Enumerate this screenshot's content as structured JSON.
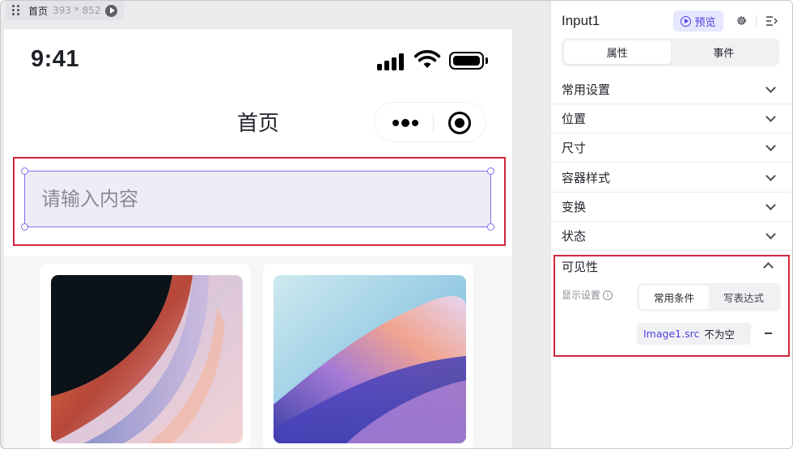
{
  "canvas": {
    "page_label": "首页",
    "page_size": "393 * 852"
  },
  "phone": {
    "time": "9:41",
    "nav_title": "首页",
    "input_placeholder": "请输入内容"
  },
  "panel": {
    "title": "Input1",
    "preview_label": "预览",
    "tabs": [
      {
        "label": "属性",
        "active": true
      },
      {
        "label": "事件",
        "active": false
      }
    ],
    "sections": [
      {
        "label": "常用设置"
      },
      {
        "label": "位置"
      },
      {
        "label": "尺寸"
      },
      {
        "label": "容器样式"
      },
      {
        "label": "变换"
      },
      {
        "label": "状态"
      }
    ],
    "visibility": {
      "title": "可见性",
      "display_label": "显示设置",
      "info_symbol": "i",
      "options": [
        {
          "label": "常用条件",
          "active": true
        },
        {
          "label": "写表达式",
          "active": false
        }
      ],
      "condition": {
        "variable": "Image1.src",
        "operator": "不为空"
      }
    }
  },
  "colors": {
    "accent": "#4c3fe0",
    "highlight": "#d1253d",
    "selection": "#7d70f0"
  }
}
